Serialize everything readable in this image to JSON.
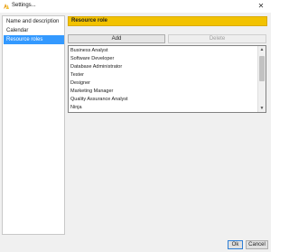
{
  "window": {
    "title": "Settings...",
    "close_glyph": "✕",
    "app_icon": "settings-app-icon"
  },
  "sidebar": {
    "items": [
      {
        "label": "Name and description",
        "selected": false
      },
      {
        "label": "Calendar",
        "selected": false
      },
      {
        "label": "Resource roles",
        "selected": true
      }
    ]
  },
  "main": {
    "section_title": "Resource role",
    "add_label": "Add",
    "delete_label": "Delete",
    "roles": [
      "Business Analyst",
      "Software Developer",
      "Database Administrator",
      "Tester",
      "Designer",
      "Marketing Manager",
      "Quality Assurance Analyst",
      "Ninja"
    ],
    "scroll_up_glyph": "▲",
    "scroll_down_glyph": "▼"
  },
  "footer": {
    "ok_label": "Ok",
    "cancel_label": "Cancel"
  },
  "colors": {
    "accent": "#f2c200",
    "selection": "#3399ff"
  }
}
